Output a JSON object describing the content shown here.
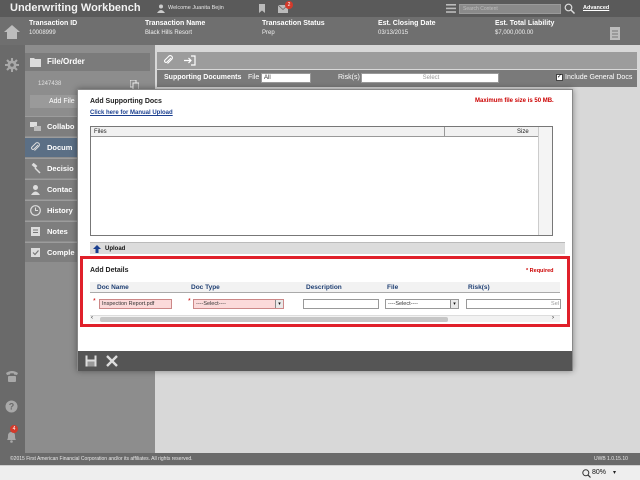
{
  "app": {
    "title": "Underwriting Workbench"
  },
  "topbar": {
    "welcome": "Welcome Juanita Bejin",
    "mail_count": "2",
    "search_placeholder": "Search Content",
    "advanced_label": "Advanced"
  },
  "transaction": {
    "columns": [
      {
        "header": "Transaction ID",
        "value": "10008999"
      },
      {
        "header": "Transaction Name",
        "value": "Black Hills Resort"
      },
      {
        "header": "Transaction Status",
        "value": "Prep"
      },
      {
        "header": "Est. Closing Date",
        "value": "03/13/2015"
      },
      {
        "header": "Est. Total Liability",
        "value": "$7,000,000.00"
      }
    ]
  },
  "nav": {
    "header": "File/Order",
    "order_number": "1247438",
    "add_file": "Add File",
    "items": [
      {
        "label": "Collabo"
      },
      {
        "label": "Docum"
      },
      {
        "label": "Decisio"
      },
      {
        "label": "Contac"
      },
      {
        "label": "History"
      },
      {
        "label": "Notes"
      },
      {
        "label": "Comple"
      }
    ]
  },
  "supporting_docs_bar": {
    "title": "Supporting Documents",
    "file_label": "File",
    "file_value": "All",
    "risks_label": "Risk(s)",
    "risks_value": "Select",
    "include_general": "Include General Docs",
    "include_general_checked": true
  },
  "modal": {
    "title": "Add Supporting Docs",
    "max_size": "Maximum file size is 50 MB.",
    "manual_upload": "Click here for Manual Upload",
    "files_col": "Files",
    "size_col": "Size",
    "upload_label": "Upload",
    "details": {
      "title": "Add Details",
      "required": "* Required",
      "columns": [
        "Doc Name",
        "Doc Type",
        "Description",
        "File",
        "Risk(s)"
      ],
      "row": {
        "doc_name": "Inspection Report.pdf",
        "doc_type": "----Select----",
        "description": "",
        "file": "----Select----",
        "risks": "Sel"
      }
    }
  },
  "footer": {
    "copyright": "©2015 First American Financial Corporation and/or its affiliates. All rights reserved.",
    "version": "UWB 1.0.15.10"
  },
  "statusbar": {
    "zoom": "80%"
  },
  "colors": {
    "required_red": "#e0202a",
    "header_blue": "#1f3f73",
    "active_nav": "#5b6f85"
  }
}
